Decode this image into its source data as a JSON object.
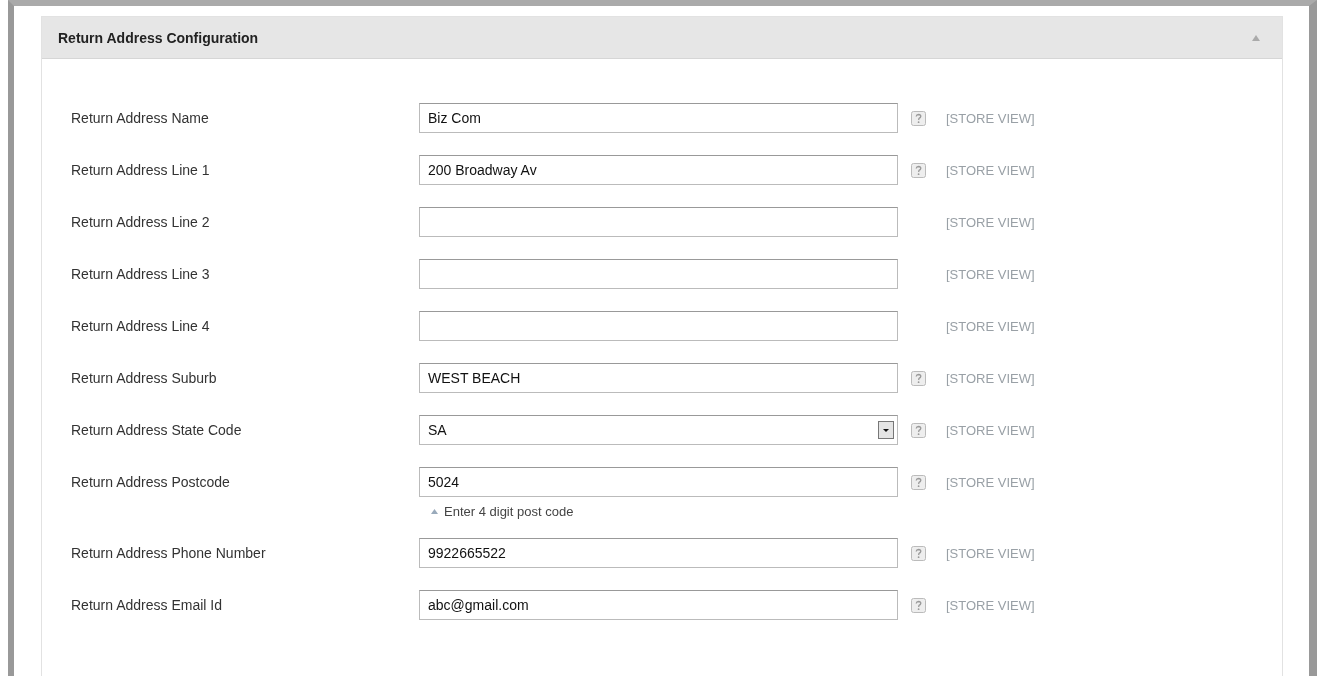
{
  "section": {
    "title": "Return Address Configuration",
    "expanded": true
  },
  "fields": [
    {
      "label": "Return Address Name",
      "kind": "text",
      "value": "Biz Com",
      "help": true,
      "scope": "[STORE VIEW]"
    },
    {
      "label": "Return Address Line 1",
      "kind": "text",
      "value": "200 Broadway Av",
      "help": true,
      "scope": "[STORE VIEW]"
    },
    {
      "label": "Return Address Line 2",
      "kind": "text",
      "help": false,
      "scope": "[STORE VIEW]"
    },
    {
      "label": "Return Address Line 3",
      "kind": "text",
      "help": false,
      "scope": "[STORE VIEW]"
    },
    {
      "label": "Return Address Line 4",
      "kind": "text",
      "help": false,
      "scope": "[STORE VIEW]"
    },
    {
      "label": "Return Address Suburb",
      "kind": "text",
      "value": "WEST BEACH",
      "help": true,
      "scope": "[STORE VIEW]"
    },
    {
      "label": "Return Address State Code",
      "kind": "select",
      "value": "SA",
      "help": true,
      "scope": "[STORE VIEW]"
    },
    {
      "label": "Return Address Postcode",
      "kind": "text",
      "value": "5024",
      "help": true,
      "scope": "[STORE VIEW]",
      "note": "Enter 4 digit post code"
    },
    {
      "label": "Return Address Phone Number",
      "kind": "text",
      "value": "9922665522",
      "help": true,
      "scope": "[STORE VIEW]"
    },
    {
      "label": "Return Address Email Id",
      "kind": "text",
      "value": "abc@gmail.com",
      "help": true,
      "scope": "[STORE VIEW]"
    }
  ]
}
